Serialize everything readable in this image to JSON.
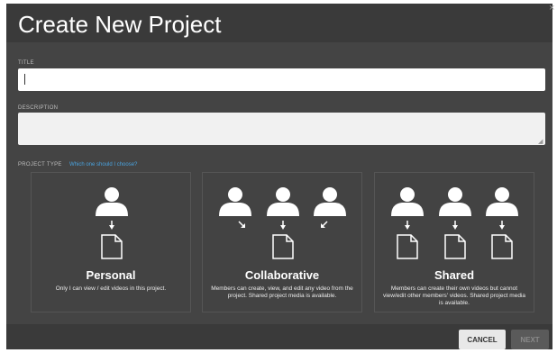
{
  "dialog": {
    "title": "Create New Project",
    "close_symbol": "×"
  },
  "form": {
    "title_label": "TITLE",
    "title_value": "",
    "description_label": "DESCRIPTION",
    "description_value": "",
    "project_type_label": "PROJECT TYPE",
    "help_link": "Which one should I choose?"
  },
  "project_types": [
    {
      "name": "Personal",
      "description": "Only I can view / edit videos in this project."
    },
    {
      "name": "Collaborative",
      "description": "Members can create, view, and edit any video from the project. Shared project media is available."
    },
    {
      "name": "Shared",
      "description": "Members can create their own videos but cannot view/edit other members' videos. Shared project media is available."
    }
  ],
  "footer": {
    "cancel_label": "CANCEL",
    "next_label": "NEXT"
  },
  "colors": {
    "background": "#444444",
    "accent_link": "#4aa3df"
  },
  "icons": [
    "user-icon",
    "arrow-down-icon",
    "arrow-down-right-icon",
    "arrow-down-left-icon",
    "document-icon",
    "close-icon"
  ]
}
